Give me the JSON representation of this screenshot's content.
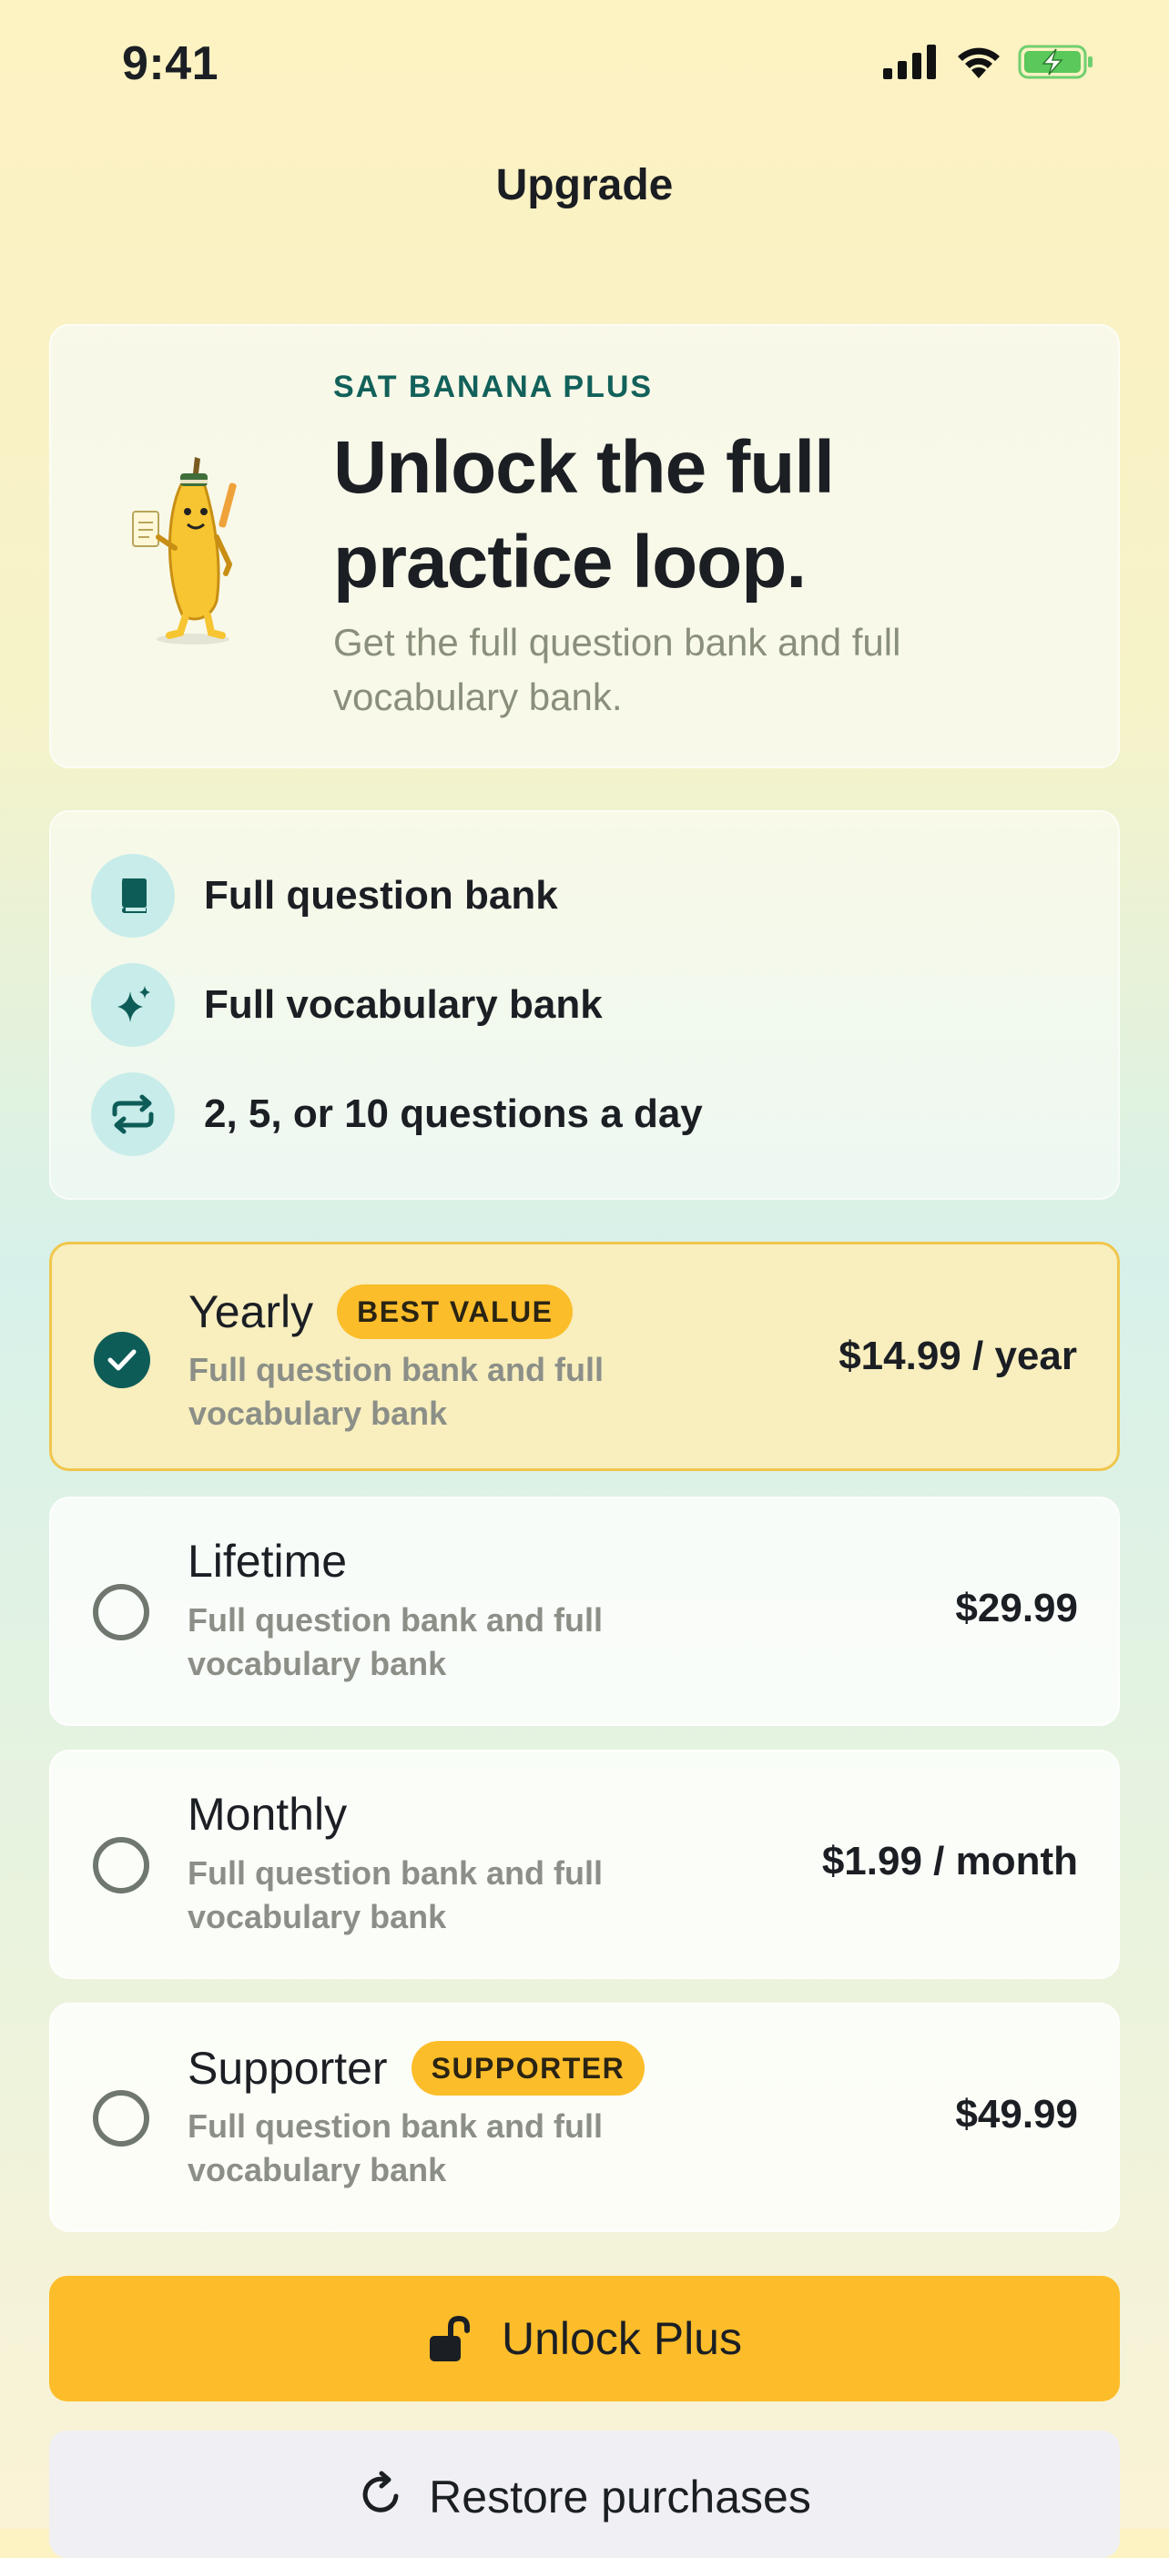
{
  "status_bar": {
    "time": "9:41"
  },
  "nav": {
    "title": "Upgrade"
  },
  "hero": {
    "eyebrow": "SAT BANANA PLUS",
    "headline": "Unlock the full practice loop.",
    "subhead": "Get the full question bank and full vocabulary bank."
  },
  "features": [
    {
      "icon": "book-icon",
      "label": "Full question bank"
    },
    {
      "icon": "sparkles-icon",
      "label": "Full vocabulary bank"
    },
    {
      "icon": "repeat-icon",
      "label": "2, 5, or 10 questions a day"
    }
  ],
  "plans": [
    {
      "name": "Yearly",
      "badge": "BEST VALUE",
      "description": "Full question bank and full vocabulary bank",
      "price": "$14.99 / year",
      "selected": true
    },
    {
      "name": "Lifetime",
      "badge": "",
      "description": "Full question bank and full vocabulary bank",
      "price": "$29.99",
      "selected": false
    },
    {
      "name": "Monthly",
      "badge": "",
      "description": "Full question bank and full vocabulary bank",
      "price": "$1.99 / month",
      "selected": false
    },
    {
      "name": "Supporter",
      "badge": "SUPPORTER",
      "description": "Full question bank and full vocabulary bank",
      "price": "$49.99",
      "selected": false
    }
  ],
  "cta": {
    "label": "Unlock Plus",
    "icon": "unlock-icon"
  },
  "restore": {
    "label": "Restore purchases",
    "icon": "refresh-icon"
  },
  "colors": {
    "accent": "#fdbd2a",
    "teal": "#0e5c57",
    "selected_bg": "#f8eebe"
  }
}
